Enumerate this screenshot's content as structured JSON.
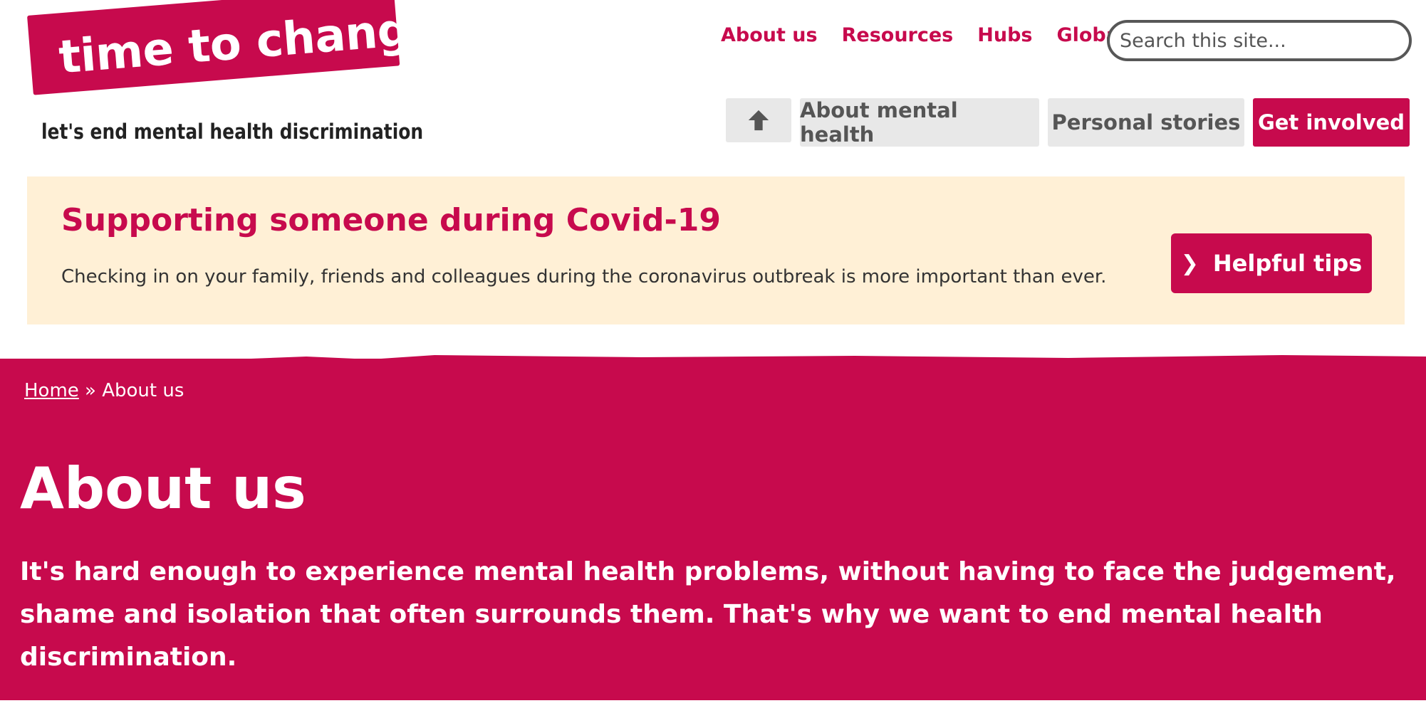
{
  "logo": {
    "banner_text": "time to change",
    "tagline": "let's end mental health discrimination"
  },
  "top_nav": {
    "items": [
      "About us",
      "Resources",
      "Hubs",
      "Global"
    ]
  },
  "search": {
    "placeholder": "Search this site..."
  },
  "main_nav": {
    "home_icon": "home-arrow-icon",
    "items": [
      "About mental health",
      "Personal stories",
      "Get involved"
    ]
  },
  "covid_banner": {
    "title": "Supporting someone during Covid-19",
    "text": "Checking in on your family, friends and colleagues during the coronavirus outbreak is more important than ever.",
    "button_label": "Helpful tips",
    "button_icon": "chevron-right-icon"
  },
  "breadcrumb": {
    "home": "Home",
    "separator": "»",
    "current": "About us"
  },
  "hero": {
    "title": "About us",
    "text": "It's hard enough to experience mental health problems, without having to face the judgement, shame and isolation that often surrounds them. That's why we want to end mental health discrimination."
  },
  "colors": {
    "brand": "#c70a4d",
    "banner_bg": "#fff0d6",
    "nav_grey": "#e8e8e8",
    "nav_text": "#555555"
  }
}
